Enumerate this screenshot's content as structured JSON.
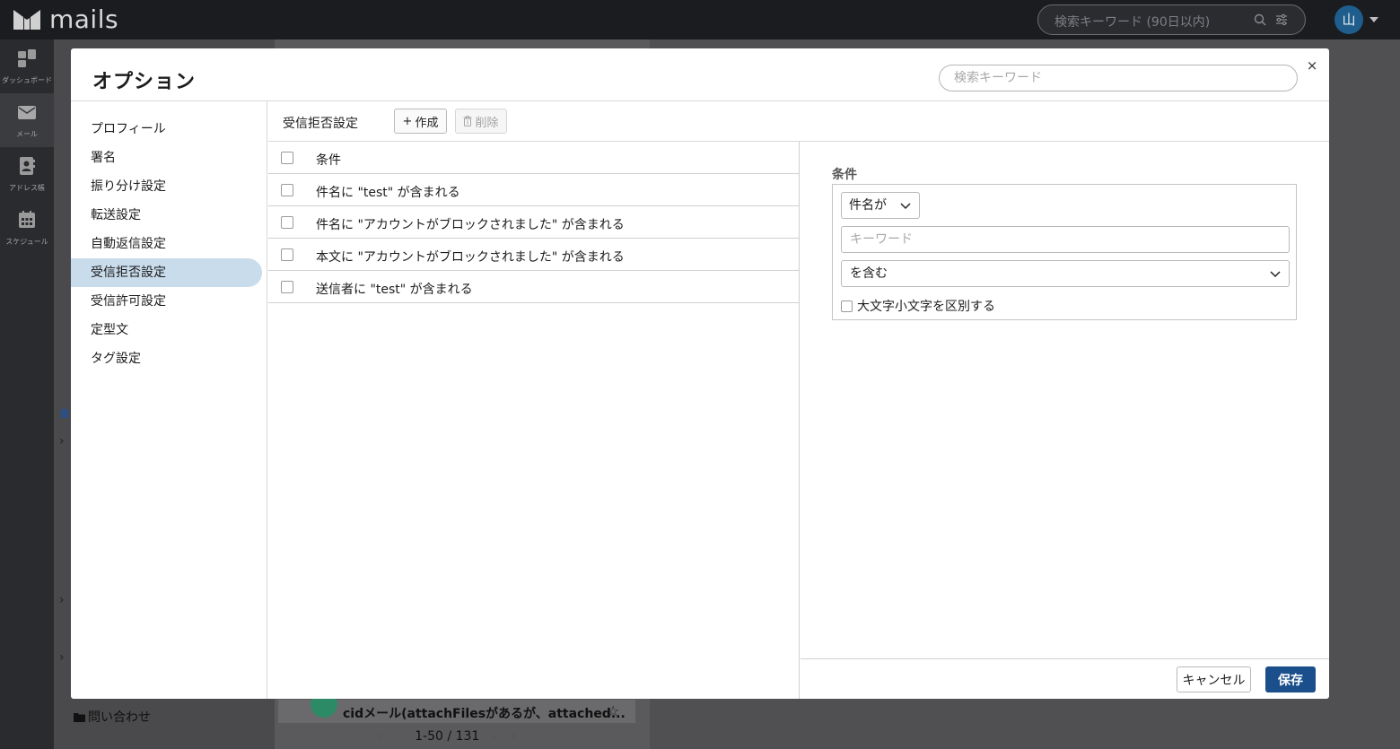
{
  "app": {
    "brand": "mails",
    "search_placeholder": "検索キーワード (90日以内)",
    "avatar_initial": "山"
  },
  "rail": [
    {
      "label": "ダッシュボード",
      "icon": "dashboard-icon"
    },
    {
      "label": "メール",
      "icon": "mail-icon"
    },
    {
      "label": "アドレス帳",
      "icon": "address-book-icon"
    },
    {
      "label": "スケジュール",
      "icon": "calendar-icon"
    }
  ],
  "background": {
    "contact_label": "問い合わせ",
    "mail_subject": "cidメール(attachFilesがあるが、attached...",
    "pager": "1-50 / 131"
  },
  "modal": {
    "title": "オプション",
    "search_placeholder": "検索キーワード",
    "close": "×",
    "menu": [
      {
        "label": "プロフィール"
      },
      {
        "label": "署名"
      },
      {
        "label": "振り分け設定"
      },
      {
        "label": "転送設定"
      },
      {
        "label": "自動返信設定"
      },
      {
        "label": "受信拒否設定",
        "active": true
      },
      {
        "label": "受信許可設定"
      },
      {
        "label": "定型文"
      },
      {
        "label": "タグ設定"
      }
    ],
    "section_title": "受信拒否設定",
    "create_label": "作成",
    "delete_label": "削除",
    "list_header": "条件",
    "rules": [
      "件名に \"test\" が含まれる",
      "件名に \"アカウントがブロックされました\" が含まれる",
      "本文に \"アカウントがブロックされました\" が含まれる",
      "送信者に \"test\" が含まれる"
    ],
    "detail": {
      "title": "条件",
      "field_value": "件名が",
      "keyword_placeholder": "キーワード",
      "match_value": "を含む",
      "case_label": "大文字小文字を区別する"
    },
    "cancel_label": "キャンセル",
    "save_label": "保存"
  },
  "colors": {
    "accent": "#1a4f8b",
    "menu_active": "#c9dcec",
    "topbar": "#1b1c20"
  }
}
